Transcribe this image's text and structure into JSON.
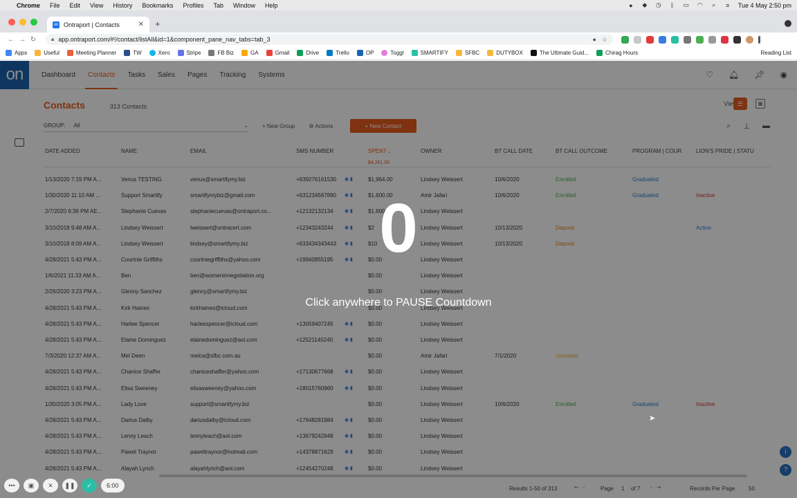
{
  "menubar": {
    "app": "Chrome",
    "items": [
      "File",
      "Edit",
      "View",
      "History",
      "Bookmarks",
      "Profiles",
      "Tab",
      "Window",
      "Help"
    ],
    "clock": "Tue 4 May  2:50 pm"
  },
  "browser": {
    "tab_title": "Ontraport | Contacts",
    "url": "app.ontraport.com/#!/contact/listAll&id=1&component_pane_nav_tabs=tab_3",
    "bookmarks": [
      "Apps",
      "Useful",
      "Meeting Planner",
      "TW",
      "Xero",
      "Stripe",
      "FB Biz",
      "GA",
      "Gmail",
      "Drive",
      "Trello",
      "OP",
      "Toggl",
      "SMARTIFY",
      "SFBC",
      "DUTYBOX",
      "The Ultimate Guid...",
      "Chirag Hours"
    ],
    "reading_list": "Reading List"
  },
  "app": {
    "logo": "on",
    "nav": [
      "Dashboard",
      "Contacts",
      "Tasks",
      "Sales",
      "Pages",
      "Tracking",
      "Systems"
    ],
    "page_title": "Contacts",
    "contact_count": "313 Contacts",
    "view_label": "View:",
    "group_label": "GROUP:",
    "group_value": "All",
    "new_group": "+ New Group",
    "actions": "⚙ Actions",
    "new_contact": "+ New Contact"
  },
  "table": {
    "headers": [
      "Date Added",
      "Name",
      "Email",
      "SMS Number",
      "Spent ↓",
      "Owner",
      "BT Call Date",
      "BT Call Outcome",
      "Program | Cour",
      "Lion's Pride | Statu"
    ],
    "spent_total": "$4,281.00",
    "rows": [
      {
        "date": "1/13/2020 7:19 PM A...",
        "name": "Venus TESTING",
        "email": "venus@smartifymy.biz",
        "sms": "+639276161530",
        "spent": "$1,964.00",
        "owner": "Lindsey Weissert",
        "call_date": "10/6/2020",
        "outcome": "Enrolled",
        "program": "Graduated",
        "pride": ""
      },
      {
        "date": "1/30/2020 11:10 AM ...",
        "name": "Support Smartify",
        "email": "smartifymybiz@gmail.com",
        "sms": "+631234567890",
        "spent": "$1,600.00",
        "owner": "Amir Jafari",
        "call_date": "10/6/2020",
        "outcome": "Enrolled",
        "program": "Graduated",
        "pride": "Inactive"
      },
      {
        "date": "2/7/2020 6:36 PM AE...",
        "name": "Stephanie Cuevas",
        "email": "stephaniecuevas@ontraport.co...",
        "sms": "+12132132134",
        "spent": "$1,600.00",
        "owner": "Lindsey Weissert",
        "call_date": "",
        "outcome": "",
        "program": "",
        "pride": ""
      },
      {
        "date": "3/10/2018 9:48 AM A...",
        "name": "Lindsey Weissert",
        "email": "lweissert@ontracert.com",
        "sms": "+12343243244",
        "spent": "$2",
        "owner": "Lindsey Weissert",
        "call_date": "10/13/2020",
        "outcome": "Deposit",
        "program": "",
        "pride": "Active"
      },
      {
        "date": "3/10/2018 8:09 AM A...",
        "name": "Lindsey Weissert",
        "email": "lindsey@smartifymy.biz",
        "sms": "+633434343443",
        "spent": "$10",
        "owner": "Lindsey Weissert",
        "call_date": "10/13/2020",
        "outcome": "Deposit",
        "program": "",
        "pride": ""
      },
      {
        "date": "4/28/2021 5:43 PM A...",
        "name": "Courtnie Griffiths",
        "email": "courtniegriffiths@yahoo.com",
        "sms": "+19940855195",
        "spent": "$0.00",
        "owner": "Lindsey Weissert",
        "call_date": "",
        "outcome": "",
        "program": "",
        "pride": ""
      },
      {
        "date": "1/6/2021 11:33 AM A...",
        "name": "Ben",
        "email": "ben@womeninnegotiation.org",
        "sms": "",
        "spent": "$0.00",
        "owner": "Lindsey Weissert",
        "call_date": "",
        "outcome": "",
        "program": "",
        "pride": ""
      },
      {
        "date": "2/26/2020 3:23 PM A...",
        "name": "Glenny Sanchez",
        "email": "glenny@smartifymy.biz",
        "sms": "",
        "spent": "$0.00",
        "owner": "Lindsey Weissert",
        "call_date": "",
        "outcome": "",
        "program": "",
        "pride": ""
      },
      {
        "date": "4/28/2021 5:43 PM A...",
        "name": "Kirk Haines",
        "email": "kirkhaines@icloud.com",
        "sms": "",
        "spent": "$0.00",
        "owner": "Lindsey Weissert",
        "call_date": "",
        "outcome": "",
        "program": "",
        "pride": ""
      },
      {
        "date": "4/28/2021 5:43 PM A...",
        "name": "Harlee Spencer",
        "email": "harleespencer@icloud.com",
        "sms": "+13059407245",
        "spent": "$0.00",
        "owner": "Lindsey Weissert",
        "call_date": "",
        "outcome": "",
        "program": "",
        "pride": ""
      },
      {
        "date": "4/28/2021 5:43 PM A...",
        "name": "Elaine Dominguez",
        "email": "elainedominguez@aol.com",
        "sms": "+12521145240",
        "spent": "$0.00",
        "owner": "Lindsey Weissert",
        "call_date": "",
        "outcome": "",
        "program": "",
        "pride": ""
      },
      {
        "date": "7/3/2020 12:37 AM A...",
        "name": "Mel Deen",
        "email": "melca@sfbc.com.au",
        "sms": "",
        "spent": "$0.00",
        "owner": "Amir Jafari",
        "call_date": "7/1/2020",
        "outcome": "Unsorted",
        "program": "",
        "pride": ""
      },
      {
        "date": "4/28/2021 5:43 PM A...",
        "name": "Chanice Shaffer",
        "email": "chaniceshaffer@yahoo.com",
        "sms": "+17130677668",
        "spent": "$0.00",
        "owner": "Lindsey Weissert",
        "call_date": "",
        "outcome": "",
        "program": "",
        "pride": ""
      },
      {
        "date": "4/28/2021 5:43 PM A...",
        "name": "Elisa Sweeney",
        "email": "elisasweeney@yahoo.com",
        "sms": "+18015760960",
        "spent": "$0.00",
        "owner": "Lindsey Weissert",
        "call_date": "",
        "outcome": "",
        "program": "",
        "pride": ""
      },
      {
        "date": "1/30/2020 3:05 PM A...",
        "name": "Lady Love",
        "email": "support@smartifymy.biz",
        "sms": "",
        "spent": "$0.00",
        "owner": "Lindsey Weissert",
        "call_date": "10/6/2020",
        "outcome": "Enrolled",
        "program": "Graduated",
        "pride": "Inactive"
      },
      {
        "date": "4/28/2021 5:43 PM A...",
        "name": "Darius Dalby",
        "email": "dariusdalby@icloud.com",
        "sms": "+17648281984",
        "spent": "$0.00",
        "owner": "Lindsey Weissert",
        "call_date": "",
        "outcome": "",
        "program": "",
        "pride": ""
      },
      {
        "date": "4/28/2021 5:43 PM A...",
        "name": "Lenny Leach",
        "email": "lennyleach@aol.com",
        "sms": "+13679242948",
        "spent": "$0.00",
        "owner": "Lindsey Weissert",
        "call_date": "",
        "outcome": "",
        "program": "",
        "pride": ""
      },
      {
        "date": "4/28/2021 5:43 PM A...",
        "name": "Pawel Traynor",
        "email": "paweltraynor@hotmail.com",
        "sms": "+14378871629",
        "spent": "$0.00",
        "owner": "Lindsey Weissert",
        "call_date": "",
        "outcome": "",
        "program": "",
        "pride": ""
      },
      {
        "date": "4/28/2021 5:43 PM A...",
        "name": "Alayah Lynch",
        "email": "alayahlynch@aol.com",
        "sms": "+12454270248",
        "spent": "$0.00",
        "owner": "Lindsey Weissert",
        "call_date": "",
        "outcome": "",
        "program": "",
        "pride": ""
      }
    ]
  },
  "footer": {
    "results": "Results 1-50 of 313",
    "page_label": "Page",
    "page_num": "1",
    "page_of": "of 7",
    "rpp_label": "Records Per Page",
    "rpp_value": "50"
  },
  "overlay": {
    "count": "0",
    "message": "Click anywhere to PAUSE Countdown"
  },
  "recorder": {
    "timer": "6:00"
  },
  "colors": {
    "accent": "#e85c1c",
    "brand": "#1b63b0"
  }
}
